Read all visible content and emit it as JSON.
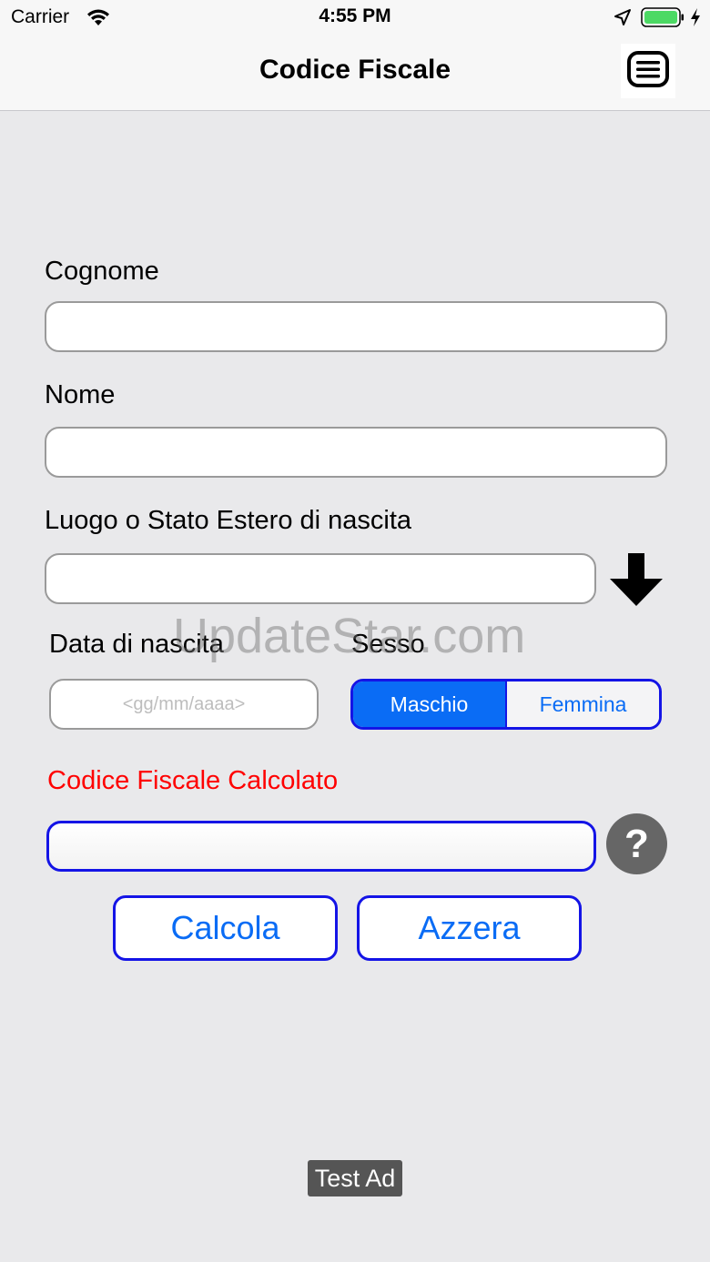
{
  "status_bar": {
    "carrier": "Carrier",
    "time": "4:55 PM",
    "icons": [
      "wifi-icon",
      "location-arrow-icon",
      "battery-icon",
      "charging-bolt-icon"
    ],
    "battery_color": "#4cd964"
  },
  "nav": {
    "title": "Codice Fiscale",
    "menu_icon": "menu-list-icon"
  },
  "form": {
    "cognome": {
      "label": "Cognome",
      "value": ""
    },
    "nome": {
      "label": "Nome",
      "value": ""
    },
    "luogo": {
      "label": "Luogo o Stato Estero di nascita",
      "value": "",
      "picker_icon": "down-arrow-icon"
    },
    "data_nascita": {
      "label": "Data di nascita",
      "value": "",
      "placeholder": "<gg/mm/aaaa>"
    },
    "sesso": {
      "label": "Sesso",
      "options": [
        "Maschio",
        "Femmina"
      ],
      "selected": "Maschio"
    },
    "risultato": {
      "label": "Codice Fiscale Calcolato",
      "value": "",
      "help_icon": "question-mark-icon",
      "help_label": "?"
    }
  },
  "actions": {
    "calcola": "Calcola",
    "azzera": "Azzera"
  },
  "watermark": "UpdateStar.com",
  "ad": {
    "label": "Test Ad"
  },
  "colors": {
    "accent": "#0a6cf5",
    "border_blue": "#1414e6",
    "result_label": "#ff0000",
    "background": "#e9e9eb"
  }
}
